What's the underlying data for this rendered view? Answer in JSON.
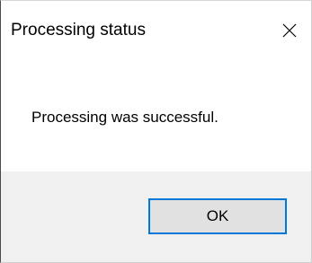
{
  "dialog": {
    "title": "Processing status",
    "close_icon": "close-icon",
    "message": "Processing was successful.",
    "ok_label": "OK"
  },
  "colors": {
    "button_border_focus": "#0078d7",
    "button_face": "#e1e1e1",
    "footer_background": "#f0f0f0",
    "content_background": "#ffffff"
  }
}
